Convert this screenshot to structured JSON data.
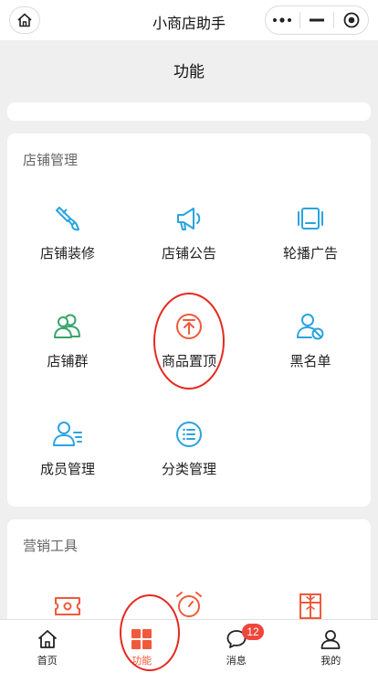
{
  "app": {
    "title": "小商店助手"
  },
  "page": {
    "title": "功能"
  },
  "shop_section": {
    "title": "店铺管理",
    "items": [
      {
        "label": "店铺装修",
        "icon": "brush-icon"
      },
      {
        "label": "店铺公告",
        "icon": "megaphone-icon"
      },
      {
        "label": "轮播广告",
        "icon": "carousel-icon"
      },
      {
        "label": "店铺群",
        "icon": "group-icon"
      },
      {
        "label": "商品置顶",
        "icon": "pin-top-icon"
      },
      {
        "label": "黑名单",
        "icon": "blacklist-user-icon"
      },
      {
        "label": "成员管理",
        "icon": "member-manage-icon"
      },
      {
        "label": "分类管理",
        "icon": "category-list-icon"
      }
    ]
  },
  "marketing_section": {
    "title": "营销工具",
    "items": [
      {
        "icon": "coupon-icon"
      },
      {
        "icon": "alarm-clock-icon"
      },
      {
        "icon": "gift-box-icon"
      }
    ]
  },
  "tabbar": {
    "tabs": [
      {
        "label": "首页",
        "icon": "home-icon"
      },
      {
        "label": "功能",
        "icon": "function-grid-icon",
        "active": true
      },
      {
        "label": "消息",
        "icon": "message-icon",
        "badge": "12"
      },
      {
        "label": "我的",
        "icon": "profile-icon"
      }
    ]
  },
  "colors": {
    "accent_blue": "#2aa4e0",
    "accent_green": "#3aa46a",
    "accent_orange": "#f05a3c",
    "annotation_red": "#e52a20"
  }
}
